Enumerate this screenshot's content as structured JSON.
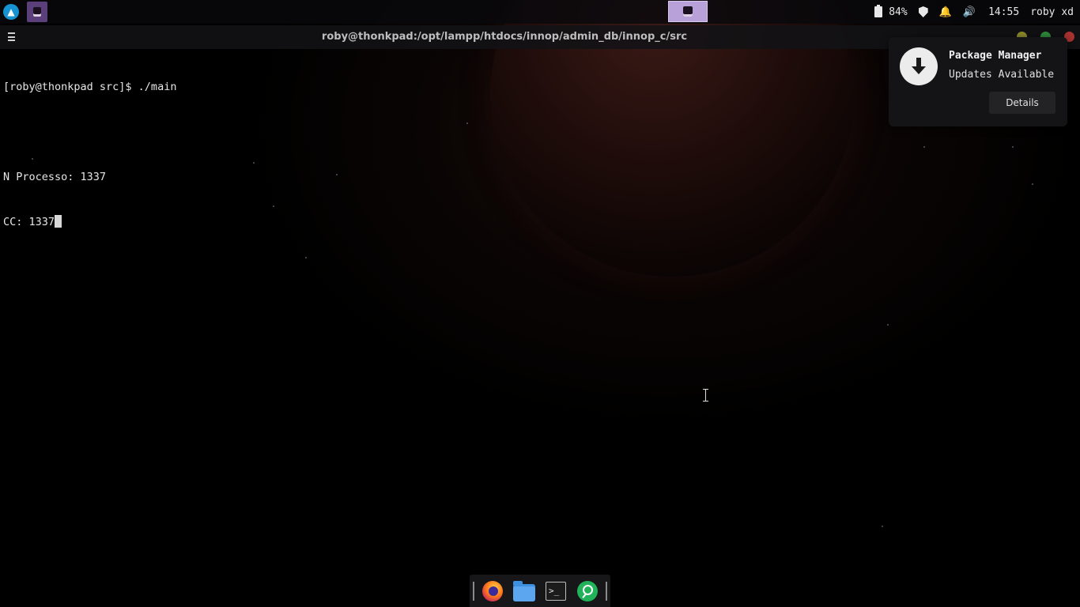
{
  "topbar": {
    "launcher_icon": "arch-logo-icon",
    "battery_percent": "84%",
    "time": "14:55",
    "user": "roby xd",
    "volume_glyph": "🔊",
    "bell_glyph": "🔔"
  },
  "terminal": {
    "title": "roby@thonkpad:/opt/lampp/htdocs/innop/admin_db/innop_c/src",
    "lines": [
      "[roby@thonkpad src]$ ./main",
      "",
      "N Processo: 1337",
      "CC: 1337"
    ]
  },
  "notification": {
    "title": "Package Manager",
    "body": "Updates Available",
    "button_label": "Details",
    "icon": "download-arrow-icon"
  },
  "dock": {
    "items": [
      "firefox-icon",
      "file-manager-icon",
      "terminal-icon",
      "search-app-icon"
    ],
    "terminal_glyph": ">_"
  },
  "colors": {
    "accent": "#1793d1",
    "active_task": "#b8a0d8",
    "close": "#a83232",
    "maximize": "#2e8a3a",
    "minimize": "#8c8a2c"
  }
}
